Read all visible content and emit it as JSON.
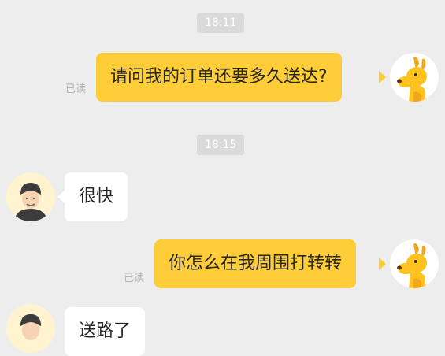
{
  "timestamps": [
    "18:11",
    "18:15"
  ],
  "messages": [
    {
      "text": "请问我的订单还要多久送达?",
      "status": "已读"
    },
    {
      "text": "很快"
    },
    {
      "text": "你怎么在我周围打转转",
      "status": "已读"
    },
    {
      "text": "送路了"
    }
  ],
  "avatars": {
    "self": "kangaroo-mascot-avatar",
    "rider": "delivery-rider-avatar"
  },
  "colors": {
    "background": "#ededed",
    "outgoing_bubble": "#ffcd37",
    "incoming_bubble": "#ffffff",
    "timestamp_pill": "#dadada"
  }
}
